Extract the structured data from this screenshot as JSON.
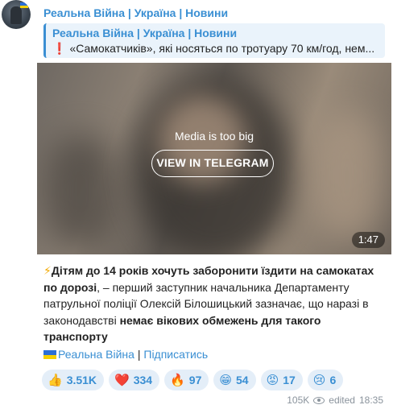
{
  "channel": {
    "name": "Реальна Війна | Україна | Новини"
  },
  "reply": {
    "title": "Реальна Війна | Україна | Новини",
    "icon": "exclamation-icon",
    "exclamation": "❗",
    "text": "«Самокатчиків», які носяться по тротуару 70 км/год, нем..."
  },
  "media": {
    "message": "Media is too big",
    "button_label": "VIEW IN TELEGRAM",
    "duration": "1:47"
  },
  "caption": {
    "bolt": "⚡",
    "bold_lead": "Дітям до 14 років хочуть заборонити їздити на самокатах по дорозі",
    "text_1": ", – перший заступник начальника Департаменту патрульної поліції Олексій Білошицький зазначає, що наразі в законодавстві ",
    "bold_tail": "немає вікових обмежень для такого транспорту"
  },
  "signature": {
    "link_text": "Реальна Війна",
    "separator": " | ",
    "subscribe_text": "Підписатись"
  },
  "reactions": [
    {
      "emoji": "👍",
      "icon": "thumbs-up-icon",
      "count": "3.51K"
    },
    {
      "emoji": "❤️",
      "icon": "heart-icon",
      "count": "334"
    },
    {
      "emoji": "🔥",
      "icon": "fire-icon",
      "count": "97"
    },
    {
      "emoji": "😁",
      "icon": "grin-icon",
      "count": "54"
    },
    {
      "emoji": "😡",
      "icon": "angry-face-icon",
      "count": "17"
    },
    {
      "emoji": "😢",
      "icon": "crying-face-icon",
      "count": "6"
    }
  ],
  "meta": {
    "views": "105K",
    "edited": "edited",
    "time": "18:35"
  },
  "colors": {
    "accent": "#3a8fd3",
    "reply_bg": "#eaf3fb",
    "reaction_bg": "#e4eef8",
    "meta_text": "#8a939c"
  }
}
